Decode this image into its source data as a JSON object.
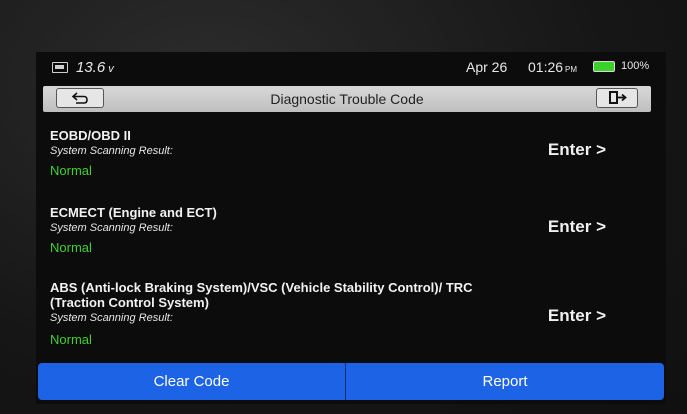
{
  "status_bar": {
    "voltage": "13.6",
    "voltage_unit": "v",
    "date": "Apr 26",
    "time": "01:26",
    "ampm": "PM",
    "battery_percent": "100%",
    "battery_color": "#3bd12a"
  },
  "header": {
    "title": "Diagnostic Trouble Code",
    "back_icon": "back-arrow-icon",
    "exit_icon": "exit-door-icon"
  },
  "items": [
    {
      "title": "EOBD/OBD II",
      "subtitle": "System Scanning Result:",
      "status": "Normal",
      "action": "Enter >"
    },
    {
      "title": "ECMECT (Engine and ECT)",
      "subtitle": "System Scanning Result:",
      "status": "Normal",
      "action": "Enter >"
    },
    {
      "title": "ABS (Anti-lock Braking System)/VSC (Vehicle Stability Control)/ TRC (Traction Control System)",
      "subtitle": "System Scanning Result:",
      "status": "Normal",
      "action": "Enter >"
    }
  ],
  "footer": {
    "clear_label": "Clear Code",
    "report_label": "Report",
    "accent": "#1c63e6"
  },
  "colors": {
    "status_normal": "#3fd12f"
  }
}
